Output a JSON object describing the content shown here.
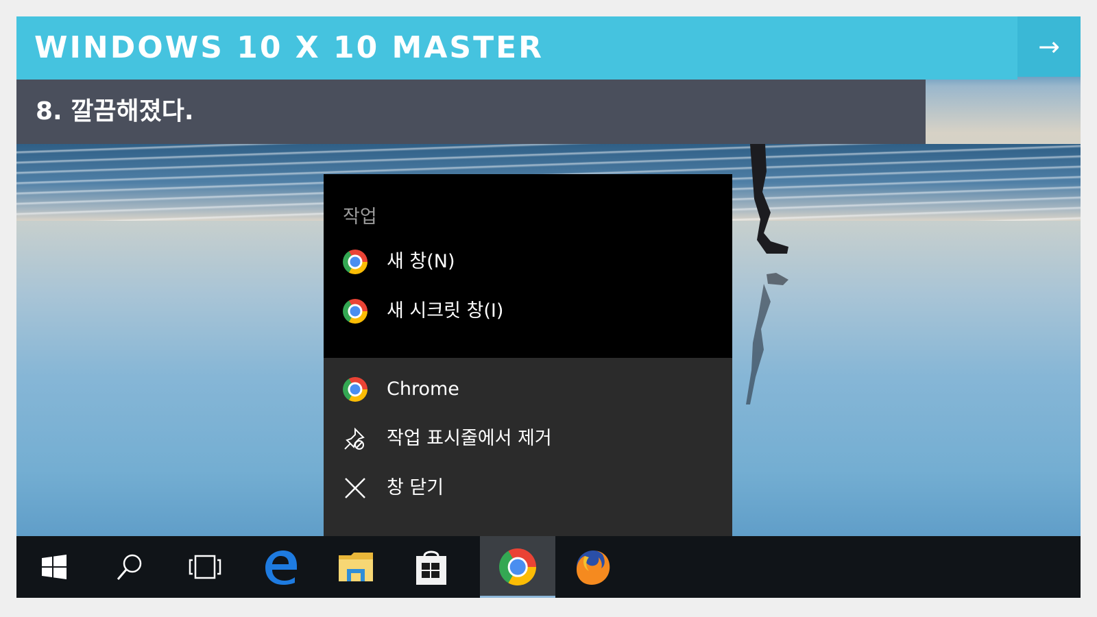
{
  "header": {
    "title": "WINDOWS 10 X 10 MASTER",
    "next_arrow": "→"
  },
  "subtitle": "8. 깔끔해졌다.",
  "jump_list": {
    "tasks_title": "작업",
    "tasks": [
      {
        "label": "새 창(N)",
        "icon": "chrome-icon"
      },
      {
        "label": "새 시크릿 창(I)",
        "icon": "chrome-icon"
      }
    ],
    "app_items": [
      {
        "label": "Chrome",
        "icon": "chrome-icon"
      },
      {
        "label": "작업 표시줄에서 제거",
        "icon": "unpin-icon"
      },
      {
        "label": "창 닫기",
        "icon": "close-icon"
      }
    ]
  },
  "taskbar": {
    "items": [
      {
        "name": "start-icon"
      },
      {
        "name": "search-icon"
      },
      {
        "name": "task-view-icon"
      },
      {
        "name": "edge-icon"
      },
      {
        "name": "file-explorer-icon"
      },
      {
        "name": "store-icon"
      },
      {
        "name": "chrome-icon",
        "active": true
      },
      {
        "name": "firefox-icon"
      }
    ]
  },
  "colors": {
    "header": "#45c3df",
    "subtitle_bar": "#4a4f5c",
    "menu_tasks_bg": "#000000",
    "menu_app_bg": "#2b2b2b",
    "taskbar_bg": "#101418"
  }
}
